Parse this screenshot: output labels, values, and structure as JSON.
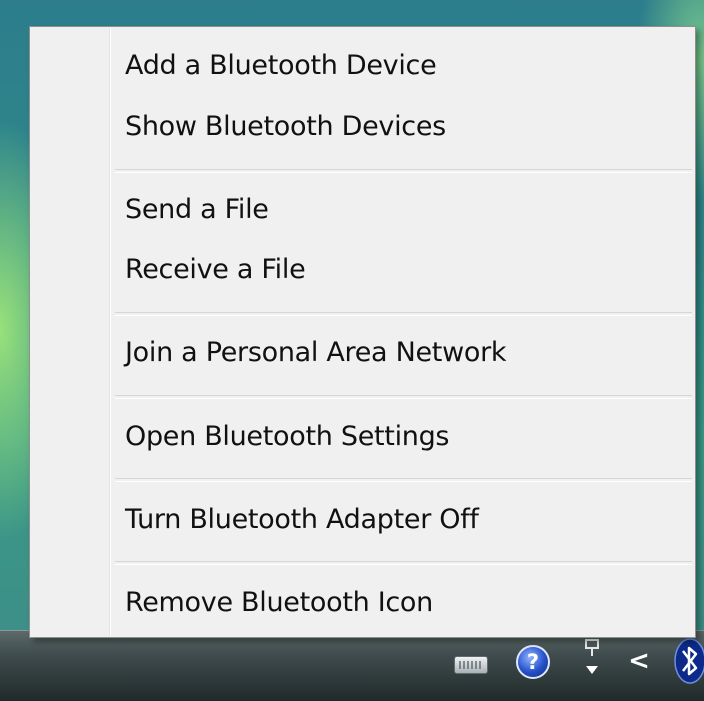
{
  "menu": {
    "groups": [
      {
        "items": [
          {
            "label": "Add a Bluetooth Device"
          },
          {
            "label": "Show Bluetooth Devices"
          }
        ]
      },
      {
        "items": [
          {
            "label": "Send a File"
          },
          {
            "label": "Receive a File"
          }
        ]
      },
      {
        "items": [
          {
            "label": "Join a Personal Area Network"
          }
        ]
      },
      {
        "items": [
          {
            "label": "Open Bluetooth Settings"
          }
        ]
      },
      {
        "items": [
          {
            "label": "Turn Bluetooth Adapter Off"
          }
        ]
      },
      {
        "items": [
          {
            "label": "Remove Bluetooth Icon"
          }
        ]
      }
    ]
  },
  "taskbar": {
    "tray_icons": [
      "keyboard-icon",
      "help-icon",
      "network-icon",
      "chevron-left-icon",
      "bluetooth-icon"
    ],
    "help_glyph": "?",
    "chevron_glyph": "<"
  },
  "colors": {
    "menu_background": "#f0f0f0",
    "menu_border": "#8e8f8f",
    "taskbar": "#2c3637",
    "desktop": "#2f8a8a"
  }
}
